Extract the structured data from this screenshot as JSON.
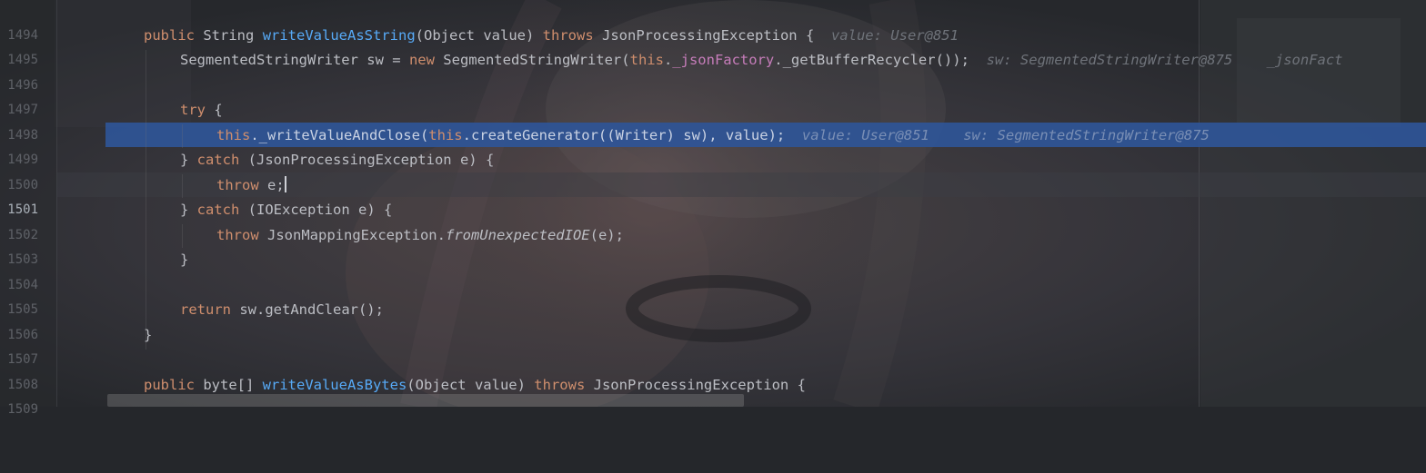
{
  "editor": {
    "lines": [
      {
        "num": "1494",
        "kind": "blank"
      },
      {
        "num": "1495",
        "kind": "l1495"
      },
      {
        "num": "1496",
        "kind": "l1496"
      },
      {
        "num": "1497",
        "kind": "blank"
      },
      {
        "num": "1498",
        "kind": "l1498"
      },
      {
        "num": "1499",
        "kind": "l1499"
      },
      {
        "num": "1500",
        "kind": "l1500"
      },
      {
        "num": "1501",
        "kind": "l1501"
      },
      {
        "num": "1502",
        "kind": "l1502"
      },
      {
        "num": "1503",
        "kind": "l1503"
      },
      {
        "num": "1504",
        "kind": "l1504"
      },
      {
        "num": "1505",
        "kind": "blank"
      },
      {
        "num": "1506",
        "kind": "l1506"
      },
      {
        "num": "1507",
        "kind": "l1507"
      },
      {
        "num": "1508",
        "kind": "blank"
      },
      {
        "num": "1509",
        "kind": "l1509"
      }
    ],
    "current_line": "1501",
    "execution_line": "1499",
    "tokens": {
      "public": "public",
      "string_type": "String",
      "method1": "writeValueAsString",
      "params1": "(Object value) ",
      "throws": "throws",
      "jpe_brace": " JsonProcessingException {",
      "hint1495": "value: User@851",
      "ssw_decl": "SegmentedStringWriter sw = ",
      "new": "new",
      "ssw_ctor": " SegmentedStringWriter(",
      "this": "this",
      "dot": ".",
      "json_factory": "_jsonFactory",
      "buf_rec": "._getBufferRecycler());",
      "hint1496a": "sw: SegmentedStringWriter@875",
      "hint1496b": "_jsonFact",
      "try": "try",
      "brace_open": " {",
      "write_close": "._writeValueAndClose(",
      "create_gen": ".createGenerator((Writer) sw), value);",
      "hint1499a": "value: User@851",
      "hint1499b": "sw: SegmentedStringWriter@875",
      "close_brace": "} ",
      "catch": "catch",
      "jpe_catch": " (JsonProcessingException e) {",
      "throw": "throw",
      "throw_e": " e;",
      "io_catch": " (IOException e) {",
      "jme": " JsonMappingException.",
      "from_ioe": "fromUnexpectedIOE",
      "from_ioe_args": "(e);",
      "lone_brace": "}",
      "return": "return",
      "get_clear": " sw.getAndClear();",
      "byte_type": " byte[] ",
      "method2": "writeValueAsBytes",
      "params2": "(Object value) ",
      "jpe_brace2": " JsonProcessingException {"
    }
  },
  "colors": {
    "background": "#25272b",
    "keyword": "#cf8e6d",
    "method": "#57aaf7",
    "field": "#c77dbb",
    "text": "#bcbec4",
    "execution_highlight": "#2f5597",
    "line_number": "#5e6167",
    "inline_hint": "#6f737a"
  }
}
